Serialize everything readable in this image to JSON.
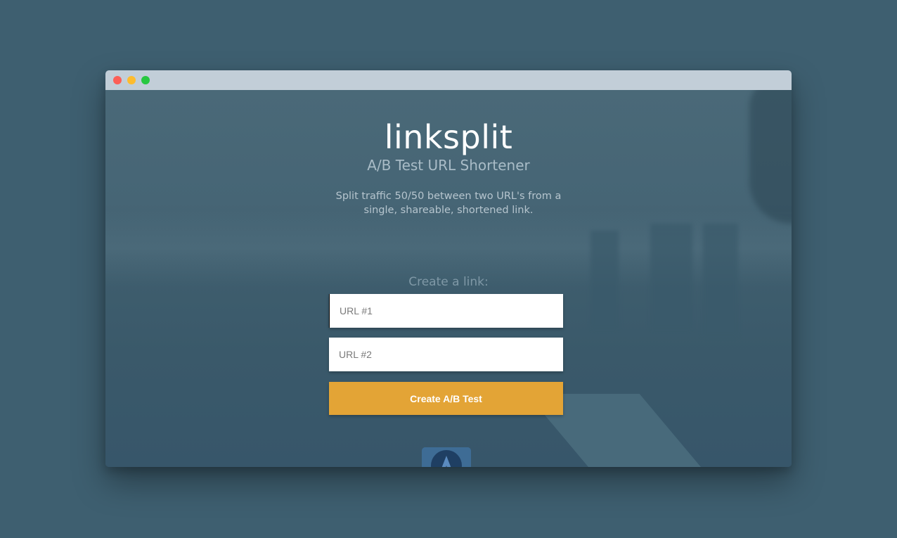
{
  "brand": {
    "name": "linksplit",
    "tagline": "A/B Test URL Shortener",
    "description": "Split traffic 50/50 between two URL's from a single, shareable, shortened link."
  },
  "form": {
    "label": "Create a link:",
    "url1_placeholder": "URL #1",
    "url1_value": "",
    "url2_placeholder": "URL #2",
    "url2_value": "",
    "submit_label": "Create A/B Test"
  },
  "icons": {
    "window_close": "close-dot-icon",
    "window_minimize": "minimize-dot-icon",
    "window_maximize": "maximize-dot-icon",
    "badge": "badge-logo-icon"
  },
  "colors": {
    "page_background": "#3e5f70",
    "titlebar": "#c2ced8",
    "accent_button": "#e3a436",
    "close": "#fc5f57",
    "minimize": "#fdbc2e",
    "maximize": "#27c840"
  }
}
